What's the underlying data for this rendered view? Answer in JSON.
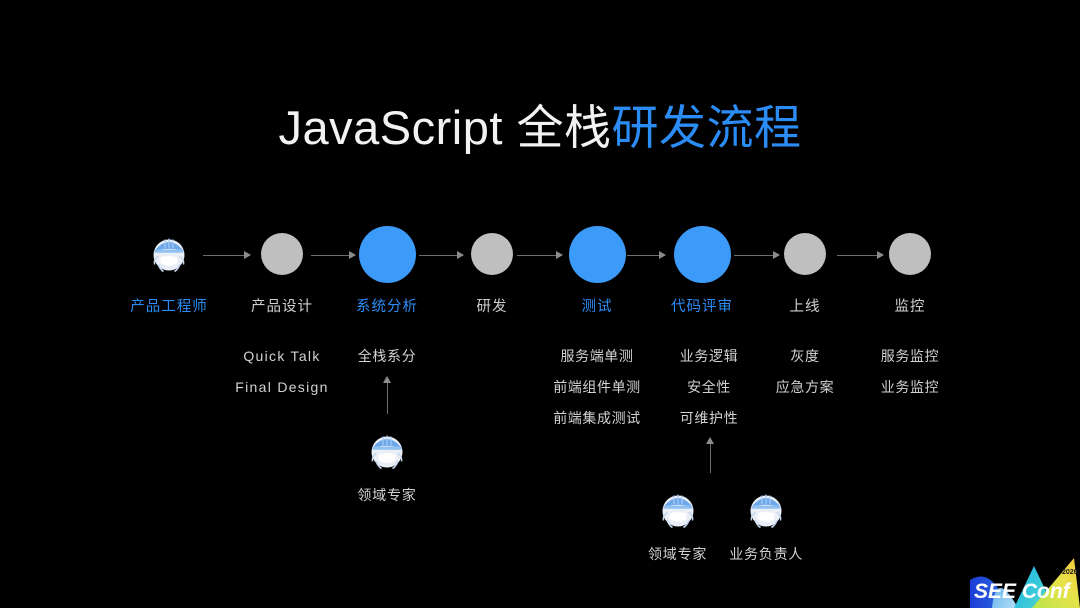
{
  "slide": {
    "background_color": "#000000",
    "title": {
      "white_part": "JavaScript 全栈",
      "blue_part": "研发流程",
      "accent_color": "#2b8cf5"
    }
  },
  "flow": {
    "nodes": [
      {
        "id": "product-engineer",
        "label": "产品工程师",
        "marker": "avatar",
        "highlight": true
      },
      {
        "id": "product-design",
        "label": "产品设计",
        "marker": "dot-gray",
        "highlight": false
      },
      {
        "id": "system-analysis",
        "label": "系统分析",
        "marker": "dot-blue",
        "highlight": true
      },
      {
        "id": "development",
        "label": "研发",
        "marker": "dot-gray",
        "highlight": false
      },
      {
        "id": "testing",
        "label": "测试",
        "marker": "dot-blue",
        "highlight": true
      },
      {
        "id": "code-review",
        "label": "代码评审",
        "marker": "dot-blue",
        "highlight": true
      },
      {
        "id": "release",
        "label": "上线",
        "marker": "dot-gray",
        "highlight": false
      },
      {
        "id": "monitoring",
        "label": "监控",
        "marker": "dot-gray",
        "highlight": false
      }
    ]
  },
  "details": {
    "product_design": [
      "Quick Talk",
      "Final Design"
    ],
    "system_analysis": [
      "全栈系分"
    ],
    "testing": [
      "服务端单测",
      "前端组件单测",
      "前端集成测试"
    ],
    "code_review": [
      "业务逻辑",
      "安全性",
      "可维护性"
    ],
    "release": [
      "灰度",
      "应急方案"
    ],
    "monitoring": [
      "服务监控",
      "业务监控"
    ]
  },
  "roles": {
    "system_analysis": [
      "领域专家"
    ],
    "code_review": [
      "领域专家",
      "业务负责人"
    ]
  },
  "logo": {
    "text": "SEE Conf",
    "superscript": "2020"
  }
}
